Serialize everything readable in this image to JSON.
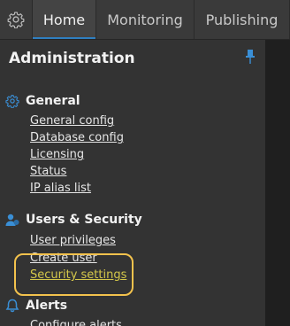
{
  "tabs": {
    "gear_icon": "gear-icon",
    "home": "Home",
    "monitoring": "Monitoring",
    "publishing": "Publishing"
  },
  "panel": {
    "title": "Administration",
    "pin_icon": "pin-icon"
  },
  "sections": {
    "general": {
      "label": "General",
      "icon": "gear-icon",
      "links": [
        "General config",
        "Database config",
        "Licensing",
        "Status",
        "IP alias list"
      ]
    },
    "users_security": {
      "label": "Users & Security",
      "icon": "user-icon",
      "links": [
        "User privileges",
        "Create user",
        "Security settings"
      ]
    },
    "alerts": {
      "label": "Alerts",
      "icon": "bell-icon",
      "links": [
        "Configure alerts"
      ]
    }
  },
  "colors": {
    "accent": "#2f7fc1",
    "highlight_link": "#d4c74a",
    "callout": "#f3c24d"
  }
}
